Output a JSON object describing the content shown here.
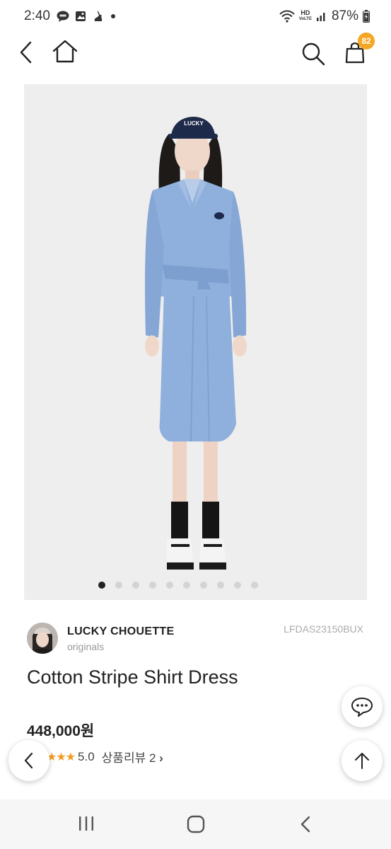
{
  "status_bar": {
    "time": "2:40",
    "hd": "HD",
    "volte": "VoLTE",
    "battery": "87%"
  },
  "cart": {
    "count": "82"
  },
  "gallery": {
    "total_images": 10,
    "active_index": 0
  },
  "brand": {
    "name": "LUCKY CHOUETTE",
    "sub": "originals",
    "sku": "LFDAS23150BUX"
  },
  "product": {
    "title": "Cotton Stripe Shirt Dress",
    "price": "448,000원",
    "stars": "★★★",
    "rating": "5.0",
    "review_label": "상품리뷰 2",
    "review_arrow": "›"
  },
  "colors": {
    "accent_badge": "#f5a623",
    "star": "#f29a1f",
    "dress_blue": "#8fb0dc"
  },
  "icons": {
    "back": "chevron-left-icon",
    "home": "home-icon",
    "search": "search-icon",
    "cart": "shopping-bag-icon",
    "chat": "chat-bubble-icon",
    "scroll_top": "arrow-up-icon",
    "prev": "chevron-left-icon"
  }
}
